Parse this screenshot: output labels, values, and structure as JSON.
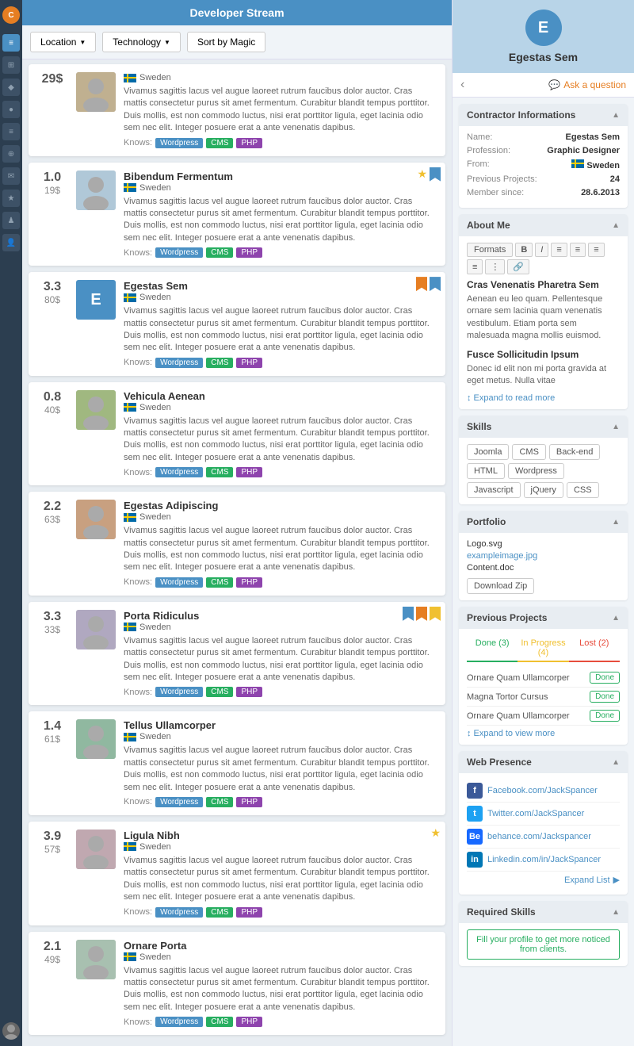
{
  "app": {
    "title": "Developer Stream",
    "logo": "C"
  },
  "header": {
    "title": "Developer Stream"
  },
  "filters": [
    {
      "label": "Location",
      "has_arrow": true
    },
    {
      "label": "Technology",
      "has_arrow": true
    },
    {
      "label": "Sort by Magic",
      "has_arrow": false
    }
  ],
  "contractors": [
    {
      "id": 1,
      "score": "29$",
      "name": "",
      "country": "Sweden",
      "desc": "Vivamus sagittis lacus vel augue laoreet rutrum faucibus dolor auctor. Cras mattis consectetur purus sit amet fermentum. Curabitur blandit tempus porttitor. Duis mollis, est non commodo luctus, nisi erat porttitor ligula, eget lacinia odio sem nec elit. Integer posuere erat a ante venenatis dapibus.",
      "tags": [
        "Wordpress",
        "CMS",
        "PHP"
      ],
      "has_bookmark_star": false,
      "bookmark_type": "none",
      "show_top": false
    },
    {
      "id": 2,
      "score": "1.0",
      "price": "19$",
      "name": "Bibendum Fermentum",
      "country": "Sweden",
      "desc": "Vivamus sagittis lacus vel augue laoreet rutrum faucibus dolor auctor. Cras mattis consectetur purus sit amet fermentum. Curabitur blandit tempus porttitor. Duis mollis, est non commodo luctus, nisi erat porttitor ligula, eget lacinia odio sem nec elit. Integer posuere erat a ante venenatis dapibus.",
      "tags": [
        "Wordpress",
        "CMS",
        "PHP"
      ],
      "has_bookmark_star": true,
      "bookmark_type": "blue"
    },
    {
      "id": 3,
      "score": "3.3",
      "price": "80$",
      "name": "Egestas Sem",
      "country": "Sweden",
      "desc": "Vivamus sagittis lacus vel augue laoreet rutrum faucibus dolor auctor. Cras mattis consectetur purus sit amet fermentum. Curabitur blandit tempus porttitor. Duis mollis, est non commodo luctus, nisi erat porttitor ligula, eget lacinia odio sem nec elit. Integer posuere erat a ante venenatis dapibus.",
      "tags": [
        "Wordpress",
        "CMS",
        "PHP"
      ],
      "has_bookmark_star": false,
      "bookmark_type": "orange_blue",
      "is_e": true
    },
    {
      "id": 4,
      "score": "0.8",
      "price": "40$",
      "name": "Vehicula Aenean",
      "country": "Sweden",
      "desc": "Vivamus sagittis lacus vel augue laoreet rutrum faucibus dolor auctor. Cras mattis consectetur purus sit amet fermentum. Curabitur blandit tempus porttitor. Duis mollis, est non commodo luctus, nisi erat porttitor ligula, eget lacinia odio sem nec elit. Integer posuere erat a ante venenatis dapibus.",
      "tags": [
        "Wordpress",
        "CMS",
        "PHP"
      ],
      "has_bookmark_star": false,
      "bookmark_type": "none"
    },
    {
      "id": 5,
      "score": "2.2",
      "price": "63$",
      "name": "Egestas Adipiscing",
      "country": "Sweden",
      "desc": "Vivamus sagittis lacus vel augue laoreet rutrum faucibus dolor auctor. Cras mattis consectetur purus sit amet fermentum. Curabitur blandit tempus porttitor. Duis mollis, est non commodo luctus, nisi erat porttitor ligula, eget lacinia odio sem nec elit. Integer posuere erat a ante venenatis dapibus.",
      "tags": [
        "Wordpress",
        "CMS",
        "PHP"
      ],
      "has_bookmark_star": false,
      "bookmark_type": "none"
    },
    {
      "id": 6,
      "score": "3.3",
      "price": "33$",
      "name": "Porta Ridiculus",
      "country": "Sweden",
      "desc": "Vivamus sagittis lacus vel augue laoreet rutrum faucibus dolor auctor. Cras mattis consectetur purus sit amet fermentum. Curabitur blandit tempus porttitor. Duis mollis, est non commodo luctus, nisi erat porttitor ligula, eget lacinia odio sem nec elit. Integer posuere erat a ante venenatis dapibus.",
      "tags": [
        "Wordpress",
        "CMS",
        "PHP"
      ],
      "has_bookmark_star": false,
      "bookmark_type": "multi"
    },
    {
      "id": 7,
      "score": "1.4",
      "price": "61$",
      "name": "Tellus Ullamcorper",
      "country": "Sweden",
      "desc": "Vivamus sagittis lacus vel augue laoreet rutrum faucibus dolor auctor. Cras mattis consectetur purus sit amet fermentum. Curabitur blandit tempus porttitor. Duis mollis, est non commodo luctus, nisi erat porttitor ligula, eget lacinia odio sem nec elit. Integer posuere erat a ante venenatis dapibus.",
      "tags": [
        "Wordpress",
        "CMS",
        "PHP"
      ],
      "has_bookmark_star": false,
      "bookmark_type": "none"
    },
    {
      "id": 8,
      "score": "3.9",
      "price": "57$",
      "name": "Ligula Nibh",
      "country": "Sweden",
      "desc": "Vivamus sagittis lacus vel augue laoreet rutrum faucibus dolor auctor. Cras mattis consectetur purus sit amet fermentum. Curabitur blandit tempus porttitor. Duis mollis, est non commodo luctus, nisi erat porttitor ligula, eget lacinia odio sem nec elit. Integer posuere erat a ante venenatis dapibus.",
      "tags": [
        "Wordpress",
        "CMS",
        "PHP"
      ],
      "has_bookmark_star": true,
      "bookmark_type": "star_only"
    },
    {
      "id": 9,
      "score": "2.1",
      "price": "49$",
      "name": "Ornare Porta",
      "country": "Sweden",
      "desc": "Vivamus sagittis lacus vel augue laoreet rutrum faucibus dolor auctor. Cras mattis consectetur purus sit amet fermentum. Curabitur blandit tempus porttitor. Duis mollis, est non commodo luctus, nisi erat porttitor ligula, eget lacinia odio sem nec elit. Integer posuere erat a ante venenatis dapibus.",
      "tags": [
        "Wordpress",
        "CMS",
        "PHP"
      ],
      "has_bookmark_star": false,
      "bookmark_type": "none"
    }
  ],
  "right_panel": {
    "avatar_letter": "E",
    "contractor_name": "Egestas Sem",
    "back_label": "‹",
    "ask_question_label": "Ask a question",
    "sections": {
      "contractor_info": {
        "title": "Contractor Informations",
        "fields": {
          "name_label": "Name:",
          "name_value": "Egestas Sem",
          "profession_label": "Profession:",
          "profession_value": "Graphic Designer",
          "from_label": "From:",
          "from_value": "Sweden",
          "projects_label": "Previous Projects:",
          "projects_value": "24",
          "member_label": "Member since:",
          "member_value": "28.6.2013"
        }
      },
      "about_me": {
        "title": "About Me",
        "toolbar": [
          "Formats",
          "B",
          "I",
          "align-left",
          "align-center",
          "align-right",
          "align-justify",
          "list",
          "link"
        ],
        "heading1": "Cras Venenatis Pharetra Sem",
        "text1": "Aenean eu leo quam. Pellentesque ornare sem lacinia quam venenatis vestibulum. Etiam porta sem malesuada magna mollis euismod.",
        "heading2": "Fusce Sollicitudin Ipsum",
        "text2": "Donec id elit non mi porta gravida at eget metus. Nulla vitae",
        "expand_label": "Expand to read more"
      },
      "skills": {
        "title": "Skills",
        "items": [
          "Joomla",
          "CMS",
          "Back-end",
          "HTML",
          "Wordpress",
          "Javascript",
          "jQuery",
          "CSS"
        ]
      },
      "portfolio": {
        "title": "Portfolio",
        "files": [
          "Logo.svg",
          "exampleimage.jpg",
          "Content.doc"
        ],
        "download_label": "Download Zip"
      },
      "previous_projects": {
        "title": "Previous Projects",
        "tabs": [
          {
            "label": "Done (3)",
            "type": "done"
          },
          {
            "label": "In Progress (4)",
            "type": "inprogress"
          },
          {
            "label": "Lost (2)",
            "type": "lost"
          }
        ],
        "items": [
          {
            "name": "Ornare Quam Ullamcorper",
            "status": "Done"
          },
          {
            "name": "Magna Tortor Cursus",
            "status": "Done"
          },
          {
            "name": "Ornare Quam Ullamcorper",
            "status": "Done"
          }
        ],
        "expand_label": "Expand to view more"
      },
      "web_presence": {
        "title": "Web Presence",
        "links": [
          {
            "icon": "f",
            "type": "fb",
            "url": "Facebook.com/JackSpancer"
          },
          {
            "icon": "t",
            "type": "tw",
            "url": "Twitter.com/JackSpancer"
          },
          {
            "icon": "be",
            "type": "be",
            "url": "behance.com/Jackspancer"
          },
          {
            "icon": "in",
            "type": "li",
            "url": "Linkedin.com/in/JackSpancer"
          }
        ],
        "expand_label": "Expand List"
      },
      "required_skills": {
        "title": "Required Skills",
        "message": "Fill your profile to get more noticed from clients."
      }
    }
  },
  "nav_icons": [
    "≡",
    "⊞",
    "♦",
    "●",
    "≡",
    "⊕",
    "✉",
    "★",
    "♟",
    "👤",
    "👤"
  ]
}
